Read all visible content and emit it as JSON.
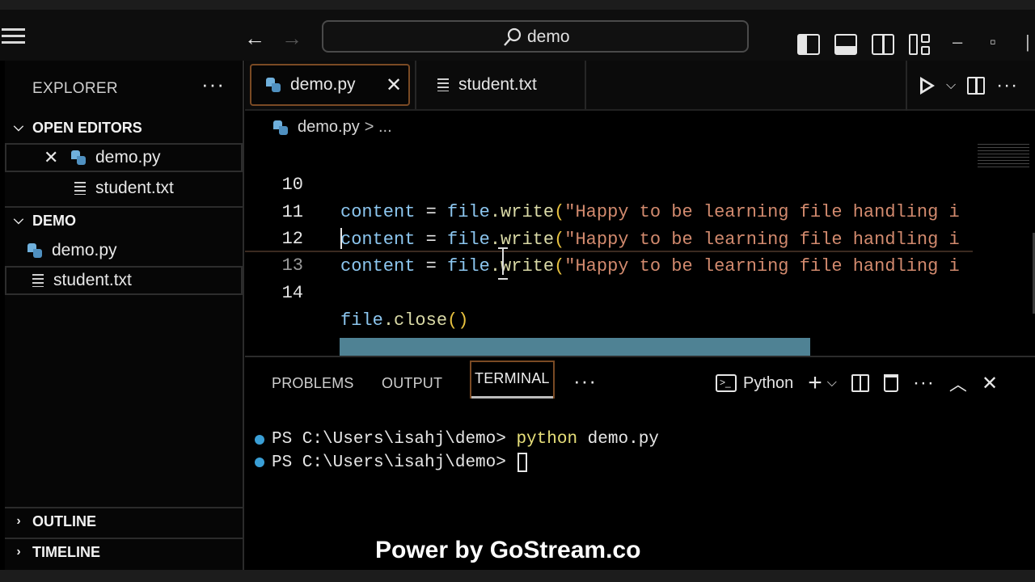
{
  "titlebar": {
    "search_text": "demo",
    "back_icon": "←",
    "forward_icon": "→",
    "minimize": "–",
    "maximize": "▫",
    "close": "X"
  },
  "sidebar": {
    "header": "EXPLORER",
    "more": "···",
    "open_editors_label": "OPEN EDITORS",
    "open_editors": [
      {
        "label": "demo.py",
        "icon": "python-file-icon"
      },
      {
        "label": "student.txt",
        "icon": "text-file-icon"
      }
    ],
    "folder_label": "DEMO",
    "files": [
      {
        "label": "demo.py",
        "icon": "python-file-icon"
      },
      {
        "label": "student.txt",
        "icon": "text-file-icon"
      }
    ],
    "outline_label": "OUTLINE",
    "timeline_label": "TIMELINE"
  },
  "tabs": [
    {
      "label": "demo.py",
      "active": true
    },
    {
      "label": "student.txt",
      "active": false
    }
  ],
  "breadcrumb": {
    "file": "demo.py",
    "rest": "> ..."
  },
  "editor": {
    "lines": [
      {
        "num": "10",
        "var": "content",
        "op": " = ",
        "obj": "file",
        "call": ".write",
        "paren": "(",
        "str": "\"Happy to be learning file handling i"
      },
      {
        "num": "11",
        "var": "content",
        "op": " = ",
        "obj": "file",
        "call": ".write",
        "paren": "(",
        "str": "\"Happy to be learning file handling i"
      },
      {
        "num": "12",
        "var": "content",
        "op": " = ",
        "obj": "file",
        "call": ".write",
        "paren": "(",
        "str": "\"Happy to be learning file handling i"
      },
      {
        "num": "13"
      },
      {
        "num": "14",
        "obj": "file",
        "call": ".close",
        "paren": "()"
      }
    ]
  },
  "panel": {
    "tabs": [
      "PROBLEMS",
      "OUTPUT",
      "TERMINAL"
    ],
    "active_tab": "TERMINAL",
    "more": "···",
    "shell_label": "Python",
    "terminal_lines": [
      {
        "prompt": "PS C:\\Users\\isahj\\demo> ",
        "cmd": "python",
        "args": " demo.py"
      },
      {
        "prompt": "PS C:\\Users\\isahj\\demo> ",
        "cmd": "",
        "args": ""
      }
    ]
  },
  "watermark": "Power by GoStream.co",
  "colors": {
    "accent_border": "#7a4a24",
    "string": "#d28a6e",
    "variable": "#8cc6ef",
    "terminal_dot": "#3a9fd6"
  }
}
